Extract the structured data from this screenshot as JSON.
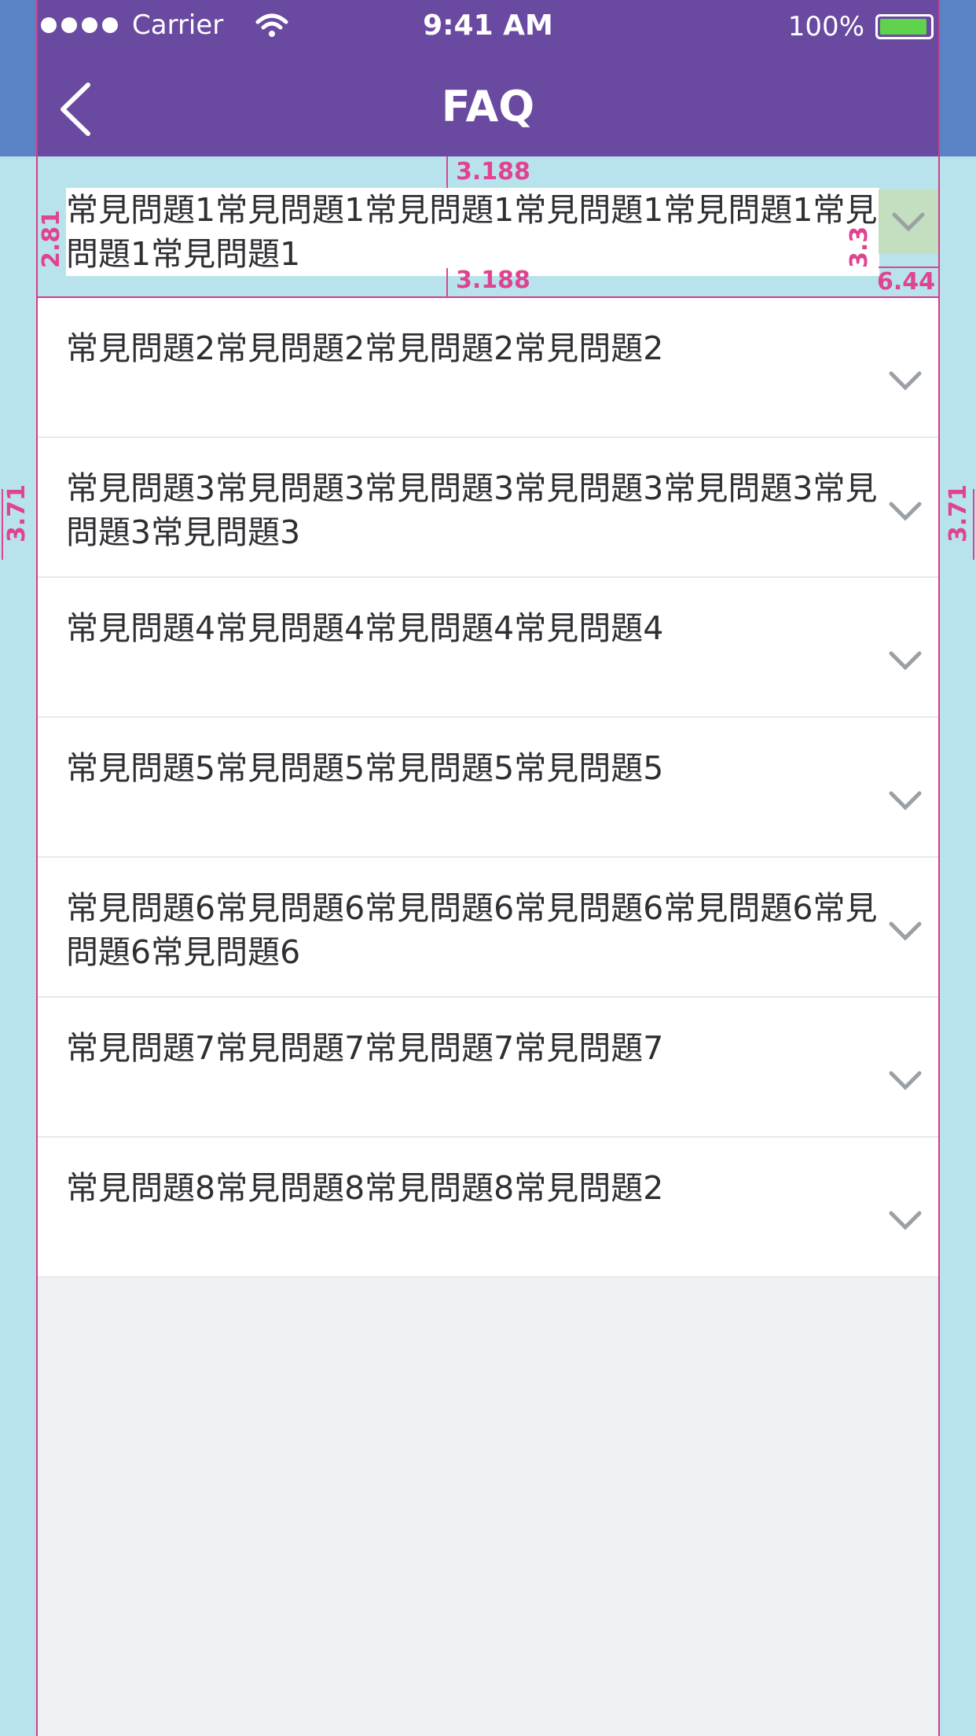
{
  "status_bar": {
    "carrier": "Carrier",
    "time": "9:41 AM",
    "battery": "100%"
  },
  "nav": {
    "title": "FAQ"
  },
  "faq_items": [
    {
      "label": "常見問題1常見問題1常見問題1常見問題1常見問題1常見問題1常見問題1"
    },
    {
      "label": "常見問題2常見問題2常見問題2常見問題2"
    },
    {
      "label": "常見問題3常見問題3常見問題3常見問題3常見問題3常見問題3常見問題3"
    },
    {
      "label": "常見問題4常見問題4常見問題4常見問題4"
    },
    {
      "label": "常見問題5常見問題5常見問題5常見問題5"
    },
    {
      "label": "常見問題6常見問題6常見問題6常見問題6常見問題6常見問題6常見問題6"
    },
    {
      "label": "常見問題7常見問題7常見問題7常見問題7"
    },
    {
      "label": "常見問題8常見問題8常見問題8常見問題2"
    }
  ],
  "annotations": {
    "top_gap": "3.188",
    "bottom_gap": "3.188",
    "left_gap": "2.81",
    "icon_gap": "3.3",
    "icon_width": "6.44",
    "side_left": "3.71",
    "side_right": "3.71"
  },
  "colors": {
    "nav_bg": "#6a4aa1",
    "annotation": "#e0438f",
    "guide_bg": "#b9e3ec"
  },
  "icons": {
    "back": "chevron-left-icon",
    "expand": "chevron-down-icon"
  }
}
